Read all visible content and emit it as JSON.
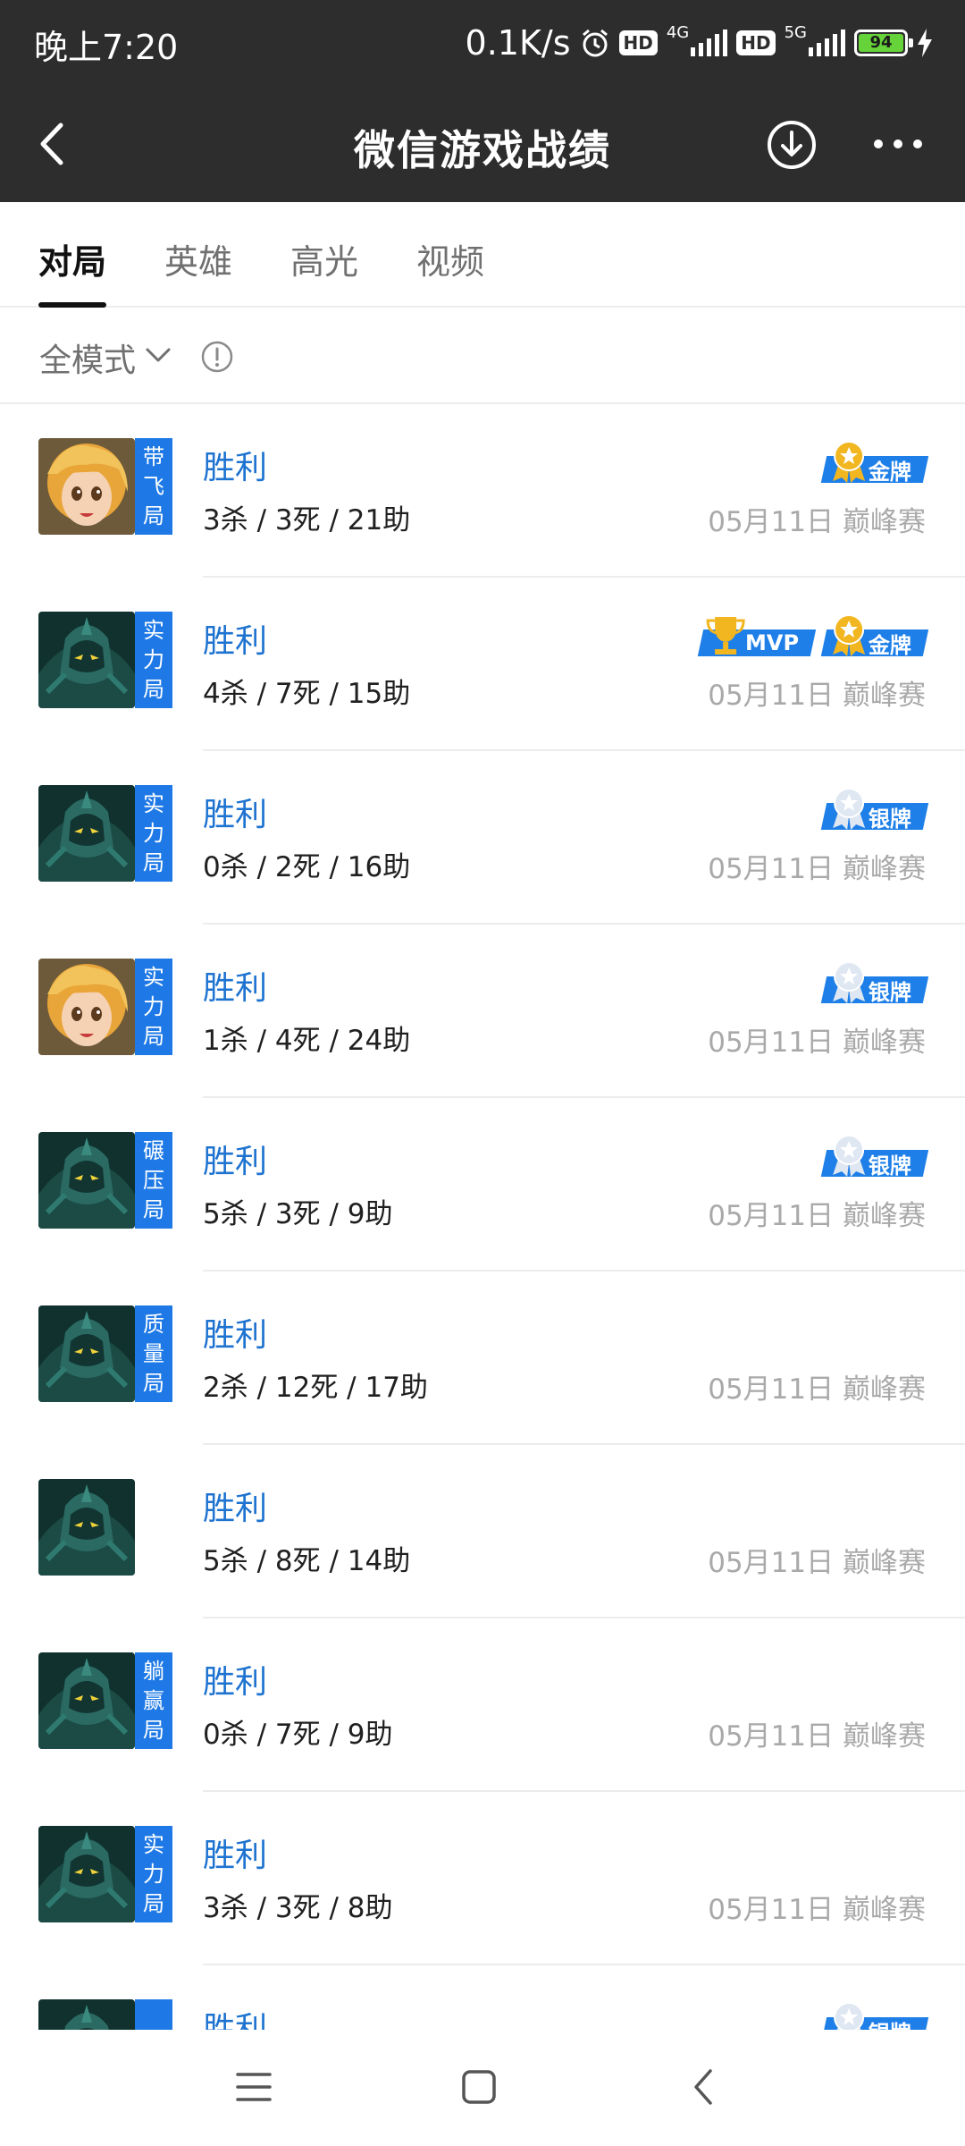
{
  "status_bar": {
    "time": "晚上7:20",
    "speed": "0.1K/s",
    "hd1": "HD",
    "net1": "4G",
    "hd2": "HD",
    "net2": "5G",
    "battery": "94",
    "battery_color": "#66d33a"
  },
  "title_bar": {
    "title": "微信游戏战绩",
    "icons": [
      "back-icon",
      "download-icon",
      "more-icon"
    ]
  },
  "tabs": [
    {
      "label": "对局",
      "active": true
    },
    {
      "label": "英雄",
      "active": false
    },
    {
      "label": "高光",
      "active": false
    },
    {
      "label": "视频",
      "active": false
    }
  ],
  "filter": {
    "mode": "全模式"
  },
  "matches": [
    {
      "hero": "blonde-girl",
      "tag": [
        "带",
        "飞",
        "局"
      ],
      "result": "胜利",
      "kda": "3杀 / 3死 / 21助",
      "date": "05月11日",
      "mode": "巅峰赛",
      "badges": [
        "金牌"
      ]
    },
    {
      "hero": "armored-warrior",
      "tag": [
        "实",
        "力",
        "局"
      ],
      "result": "胜利",
      "kda": "4杀 / 7死 / 15助",
      "date": "05月11日",
      "mode": "巅峰赛",
      "badges": [
        "MVP",
        "金牌"
      ]
    },
    {
      "hero": "armored-warrior",
      "tag": [
        "实",
        "力",
        "局"
      ],
      "result": "胜利",
      "kda": "0杀 / 2死 / 16助",
      "date": "05月11日",
      "mode": "巅峰赛",
      "badges": [
        "银牌"
      ]
    },
    {
      "hero": "blonde-girl",
      "tag": [
        "实",
        "力",
        "局"
      ],
      "result": "胜利",
      "kda": "1杀 / 4死 / 24助",
      "date": "05月11日",
      "mode": "巅峰赛",
      "badges": [
        "银牌"
      ]
    },
    {
      "hero": "armored-warrior",
      "tag": [
        "碾",
        "压",
        "局"
      ],
      "result": "胜利",
      "kda": "5杀 / 3死 / 9助",
      "date": "05月11日",
      "mode": "巅峰赛",
      "badges": [
        "银牌"
      ]
    },
    {
      "hero": "armored-warrior",
      "tag": [
        "质",
        "量",
        "局"
      ],
      "result": "胜利",
      "kda": "2杀 / 12死 / 17助",
      "date": "05月11日",
      "mode": "巅峰赛",
      "badges": []
    },
    {
      "hero": "armored-warrior",
      "tag": [],
      "result": "胜利",
      "kda": "5杀 / 8死 / 14助",
      "date": "05月11日",
      "mode": "巅峰赛",
      "badges": []
    },
    {
      "hero": "armored-warrior",
      "tag": [
        "躺",
        "赢",
        "局"
      ],
      "result": "胜利",
      "kda": "0杀 / 7死 / 9助",
      "date": "05月11日",
      "mode": "巅峰赛",
      "badges": []
    },
    {
      "hero": "armored-warrior",
      "tag": [
        "实",
        "力",
        "局"
      ],
      "result": "胜利",
      "kda": "3杀 / 3死 / 8助",
      "date": "05月11日",
      "mode": "巅峰赛",
      "badges": []
    },
    {
      "hero": "armored-warrior",
      "tag": [
        "碾"
      ],
      "result": "胜利",
      "kda": "",
      "date": "",
      "mode": "",
      "badges": [
        "银牌"
      ]
    }
  ],
  "colors": {
    "header_bg": "#2d2d2d",
    "accent_blue": "#1e79e6",
    "result_blue": "#1e73d0",
    "gold_medal": "#f2b620",
    "silver_medal": "#dfe7f2"
  },
  "nav_bar": {
    "icons": [
      "menu-icon",
      "home-icon",
      "back-icon"
    ]
  }
}
